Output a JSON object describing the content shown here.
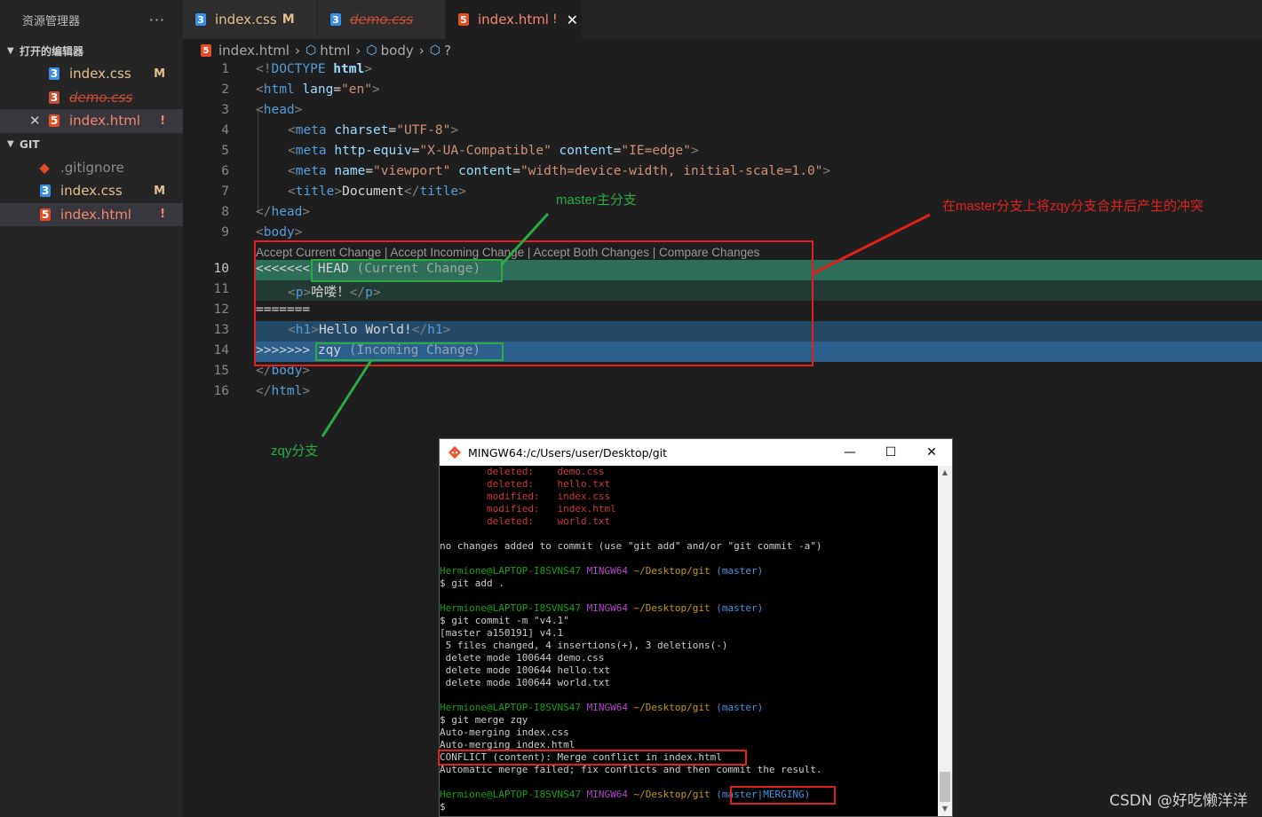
{
  "sidebar": {
    "title": "资源管理器",
    "more": "···",
    "open_editors": {
      "label": "打开的编辑器",
      "items": [
        {
          "name": "index.css",
          "badge": "M"
        },
        {
          "name": "demo.css",
          "badge": ""
        },
        {
          "name": "index.html",
          "badge": "!"
        }
      ]
    },
    "git": {
      "label": "GIT",
      "items": [
        {
          "name": ".gitignore",
          "badge": ""
        },
        {
          "name": "index.css",
          "badge": "M"
        },
        {
          "name": "index.html",
          "badge": "!"
        }
      ]
    }
  },
  "tabs": [
    {
      "label": "index.css",
      "flag": "M"
    },
    {
      "label": "demo.css",
      "flag": ""
    },
    {
      "label": "index.html",
      "flag": "!"
    }
  ],
  "breadcrumb": [
    "index.html",
    "html",
    "body",
    "?"
  ],
  "codelens": "Accept Current Change | Accept Incoming Change | Accept Both Changes | Compare Changes",
  "lines": [
    "1",
    "2",
    "3",
    "4",
    "5",
    "6",
    "7",
    "8",
    "9",
    "10",
    "11",
    "12",
    "13",
    "14",
    "15",
    "16"
  ],
  "code": {
    "l1": {
      "a": "<!",
      "b": "DOCTYPE",
      "c": " html",
      "d": ">"
    },
    "l2": {
      "a": "<",
      "b": "html",
      "c": " lang",
      "d": "=",
      "e": "\"en\"",
      "f": ">"
    },
    "l3": {
      "a": "<",
      "b": "head",
      "c": ">"
    },
    "l4": {
      "a": "<",
      "b": "meta",
      "c": " charset",
      "d": "=",
      "e": "\"UTF-8\"",
      "f": ">"
    },
    "l5": {
      "a": "<",
      "b": "meta",
      "c": " http-equiv",
      "d": "=",
      "e": "\"X-UA-Compatible\"",
      "g": " content",
      "h": "=",
      "i": "\"IE=edge\"",
      "f": ">"
    },
    "l6": {
      "a": "<",
      "b": "meta",
      "c": " name",
      "d": "=",
      "e": "\"viewport\"",
      "g": " content",
      "h": "=",
      "i": "\"width=device-width, initial-scale=1.0\"",
      "f": ">"
    },
    "l7": {
      "a": "<",
      "b": "title",
      "c": ">",
      "d": "Document",
      "e": "</",
      "f": "title",
      "g": ">"
    },
    "l8": {
      "a": "</",
      "b": "head",
      "c": ">"
    },
    "l9": {
      "a": "<",
      "b": "body",
      "c": ">"
    },
    "l10": {
      "a": "<<<<<<<",
      "b": " HEAD",
      "c": " (Current Change)"
    },
    "l11": {
      "a": "<",
      "b": "p",
      "c": ">",
      "d": "哈喽！",
      "e": "</",
      "f": "p",
      "g": ">"
    },
    "l12": {
      "a": "======="
    },
    "l13": {
      "a": "<",
      "b": "h1",
      "c": ">",
      "d": "Hello World!",
      "e": "</",
      "f": "h1",
      "g": ">"
    },
    "l14": {
      "a": ">>>>>>>",
      "b": " zqy",
      "c": " (Incoming Change)"
    },
    "l15": {
      "a": "</",
      "b": "body",
      "c": ">"
    },
    "l16": {
      "a": "</",
      "b": "html",
      "c": ">"
    }
  },
  "annotations": {
    "master": "master主分支",
    "zqy": "zqy分支",
    "conflict": "在master分支上将zqy分支合并后产生的冲突"
  },
  "terminal": {
    "title": "MINGW64:/c/Users/user/Desktop/git",
    "minimize": "—",
    "maximize": "☐",
    "close": "✕",
    "status": [
      {
        "k": "deleted:",
        "v": "demo.css"
      },
      {
        "k": "deleted:",
        "v": "hello.txt"
      },
      {
        "k": "modified:",
        "v": "index.css"
      },
      {
        "k": "modified:",
        "v": "index.html"
      },
      {
        "k": "deleted:",
        "v": "world.txt"
      }
    ],
    "no_changes": "no changes added to commit (use \"git add\" and/or \"git commit -a\")",
    "user": "Hermione@LAPTOP-I8SVNS47",
    "sys": "MINGW64",
    "path": "~/Desktop/git",
    "branch": "(master)",
    "branch_merging": "(master|MERGING)",
    "cmd_add": "$ git add .",
    "cmd_commit": "$ git commit -m \"v4.1\"",
    "commit_out": [
      "[master a150191] v4.1",
      " 5 files changed, 4 insertions(+), 3 deletions(-)",
      " delete mode 100644 demo.css",
      " delete mode 100644 hello.txt",
      " delete mode 100644 world.txt"
    ],
    "cmd_merge": "$ git merge zqy",
    "merge_out": [
      "Auto-merging index.css",
      "Auto-merging index.html"
    ],
    "conflict_line": "CONFLICT (content): Merge conflict in index.html",
    "failed_line": "Automatic merge failed; fix conflicts and then commit the result.",
    "prompt": "$"
  },
  "watermark": "CSDN @好吃懒洋洋"
}
